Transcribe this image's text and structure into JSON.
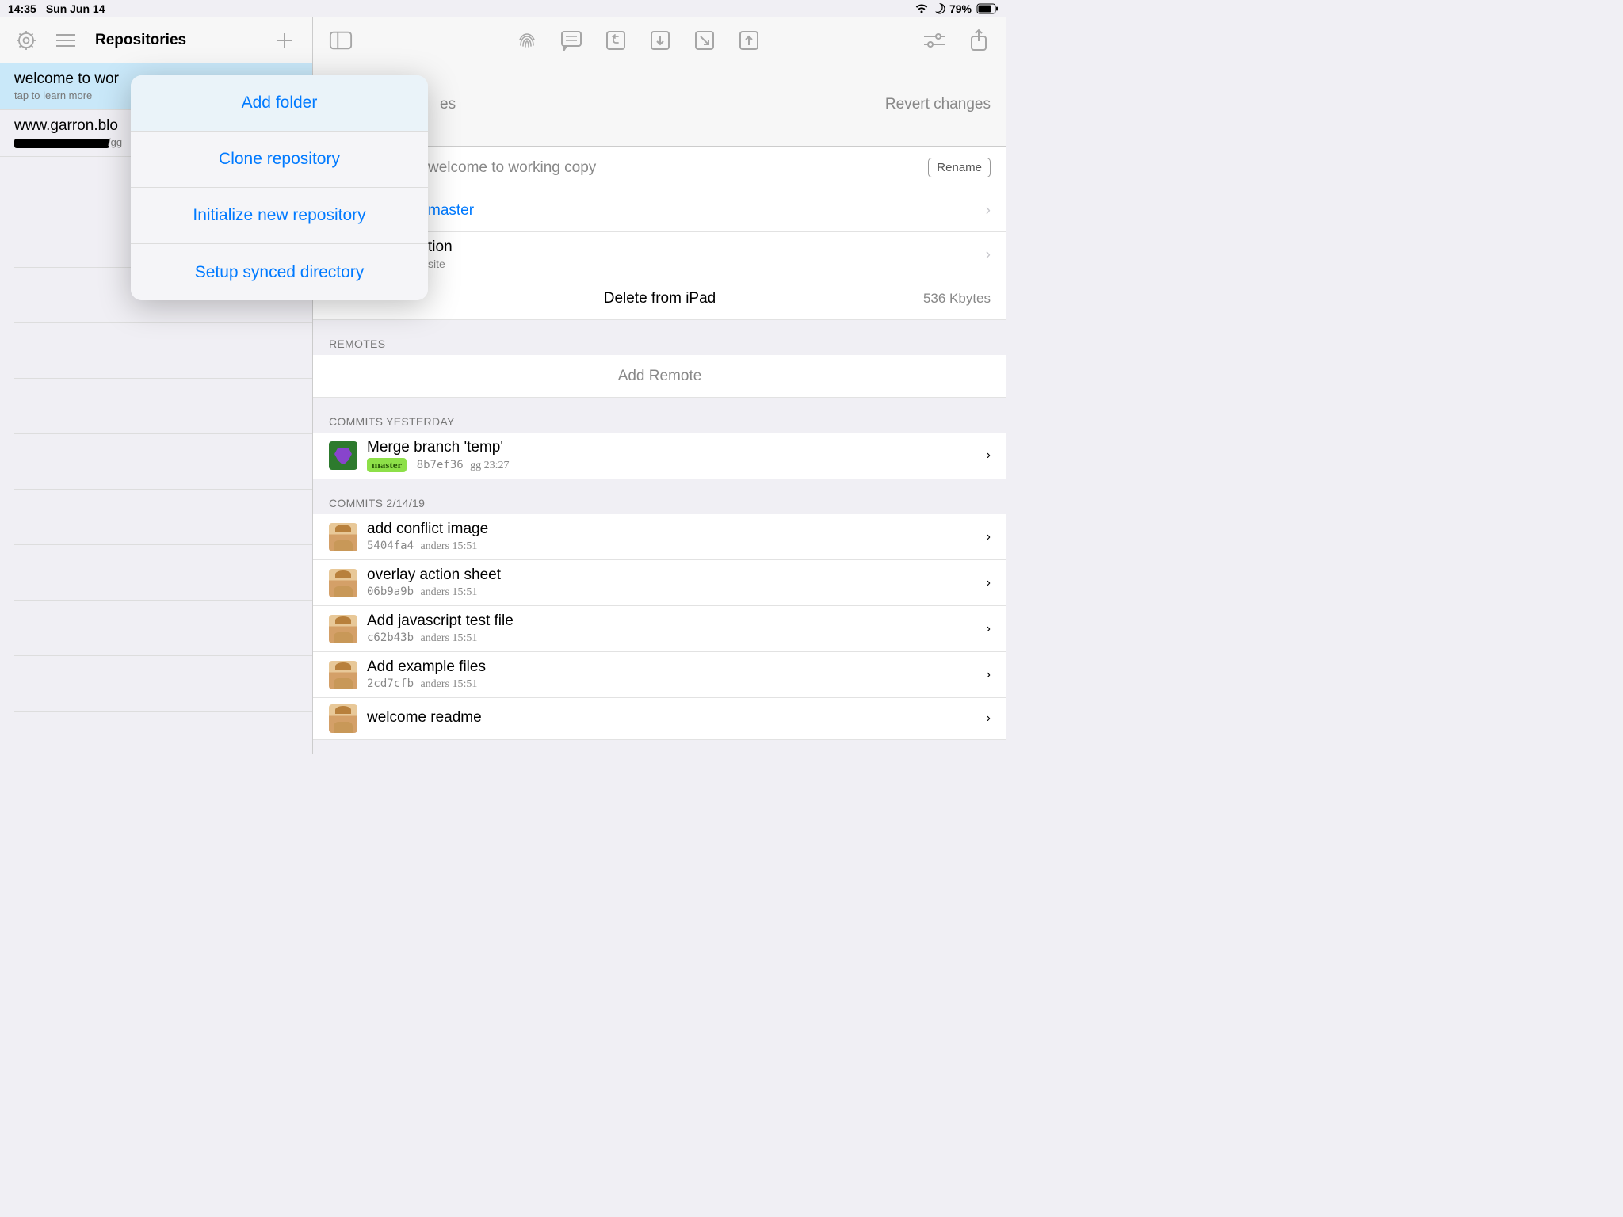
{
  "status": {
    "time": "14:35",
    "date": "Sun Jun 14",
    "battery": "79%"
  },
  "toolbar": {
    "title": "Repositories"
  },
  "sidebar": {
    "items": [
      {
        "title": "welcome to wor",
        "sub": "tap to learn more"
      },
      {
        "title": "www.garron.blo",
        "sub": "/gg"
      }
    ]
  },
  "popover": {
    "items": [
      "Add folder",
      "Clone repository",
      "Initialize new repository",
      "Setup synced directory"
    ]
  },
  "detail": {
    "header_right": "Revert changes",
    "header_left_suffix": "es",
    "name_value": "welcome to working copy",
    "rename": "Rename",
    "branch_value": "master",
    "config_suffix": "tion",
    "config_sub": "site",
    "delete": "Delete from iPad",
    "size": "536 Kbytes",
    "remotes": "REMOTES",
    "add_remote": "Add Remote",
    "commits_y": "COMMITS YESTERDAY",
    "commits_d": "COMMITS 2/14/19",
    "commits1": [
      {
        "title": "Merge branch 'temp'",
        "badge": "master",
        "hash": "8b7ef36",
        "meta": "gg 23:27"
      }
    ],
    "commits2": [
      {
        "title": "add conflict image",
        "hash": "5404fa4",
        "meta": "anders 15:51"
      },
      {
        "title": "overlay action sheet",
        "hash": "06b9a9b",
        "meta": "anders 15:51"
      },
      {
        "title": "Add javascript test file",
        "hash": "c62b43b",
        "meta": "anders 15:51"
      },
      {
        "title": "Add example files",
        "hash": "2cd7cfb",
        "meta": "anders 15:51"
      },
      {
        "title": "welcome readme",
        "hash": "",
        "meta": ""
      }
    ]
  }
}
